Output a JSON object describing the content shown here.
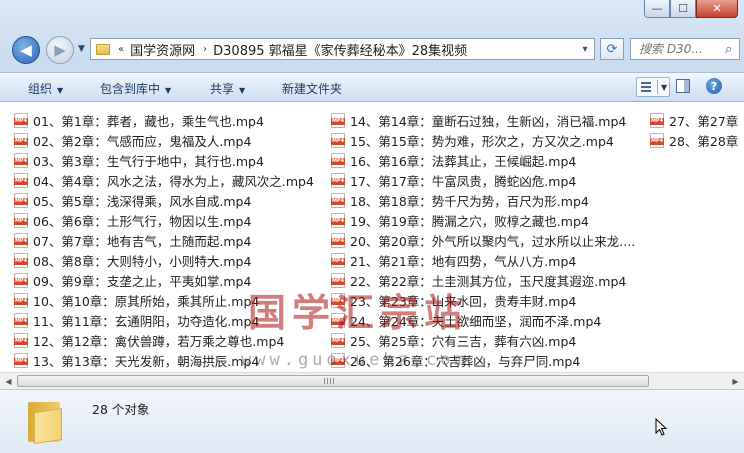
{
  "window": {
    "controls": {
      "minimize": "—",
      "maximize": "☐",
      "close": "✕"
    }
  },
  "nav": {
    "back_icon": "back-arrow-icon",
    "forward_icon": "forward-arrow-icon",
    "address": {
      "overflow": "«",
      "crumbs": [
        "国学资源网",
        "D30895 郭福星《家传葬经秘本》28集视频"
      ],
      "separator": "›",
      "dropdown": "▾"
    },
    "refresh": "⟳",
    "search_placeholder": "搜索 D30...",
    "search_icon": "⌕"
  },
  "toolbar": {
    "organize": "组织",
    "include": "包含到库中",
    "share": "共享",
    "new_folder": "新建文件夹",
    "arrow": "▼"
  },
  "files": {
    "col1": [
      "01、第1章：葬者，藏也，乘生气也.mp4",
      "02、第2章：气感而应，鬼福及人.mp4",
      "03、第3章：生气行于地中，其行也.mp4",
      "04、第4章：风水之法，得水为上，藏风次之.mp4",
      "05、第5章：浅深得乘，风水自成.mp4",
      "06、第6章：土形气行，物因以生.mp4",
      "07、第7章：地有吉气，土随而起.mp4",
      "08、第8章：大则特小，小则特大.mp4",
      "09、第9章：支垄之止，平夷如掌.mp4",
      "10、第10章：原其所始，乘其所止.mp4",
      "11、第11章：玄通阴阳，功夺造化.mp4",
      "12、第12章：禽伏兽蹲，若万乘之尊也.mp4",
      "13、第13章：天光发新，朝海拱辰.mp4"
    ],
    "col2": [
      "14、第14章：童断石过独，生新凶，消已福.mp4",
      "15、第15章：势为难，形次之，方又次之.mp4",
      "16、第16章：法葬其止，王候崛起.mp4",
      "17、第17章：牛富凤贵，腾蛇凶危.mp4",
      "18、第18章：势千尺为势，百尺为形.mp4",
      "19、第19章：腾漏之穴，败椁之藏也.mp4",
      "20、第20章：外气所以聚内气，过水所以止来龙....",
      "21、第21章：地有四势，气从八方.mp4",
      "22、第22章：土圭测其方位，玉尺度其遐迩.mp4",
      "23、第23章：山来水回，贵寿丰财.mp4",
      "24、第24章：夫土欲细而坚，润而不泽.mp4",
      "25、第25章：穴有三吉，葬有六凶.mp4",
      "26、 第26章：穴吉葬凶，与弃尸同.mp4"
    ],
    "col3": [
      "27、第27章",
      "28、第28章"
    ]
  },
  "watermark": {
    "title": "国学汇宗站",
    "url": "www.guoxuehz.com"
  },
  "details": {
    "count": "28 个对象"
  }
}
